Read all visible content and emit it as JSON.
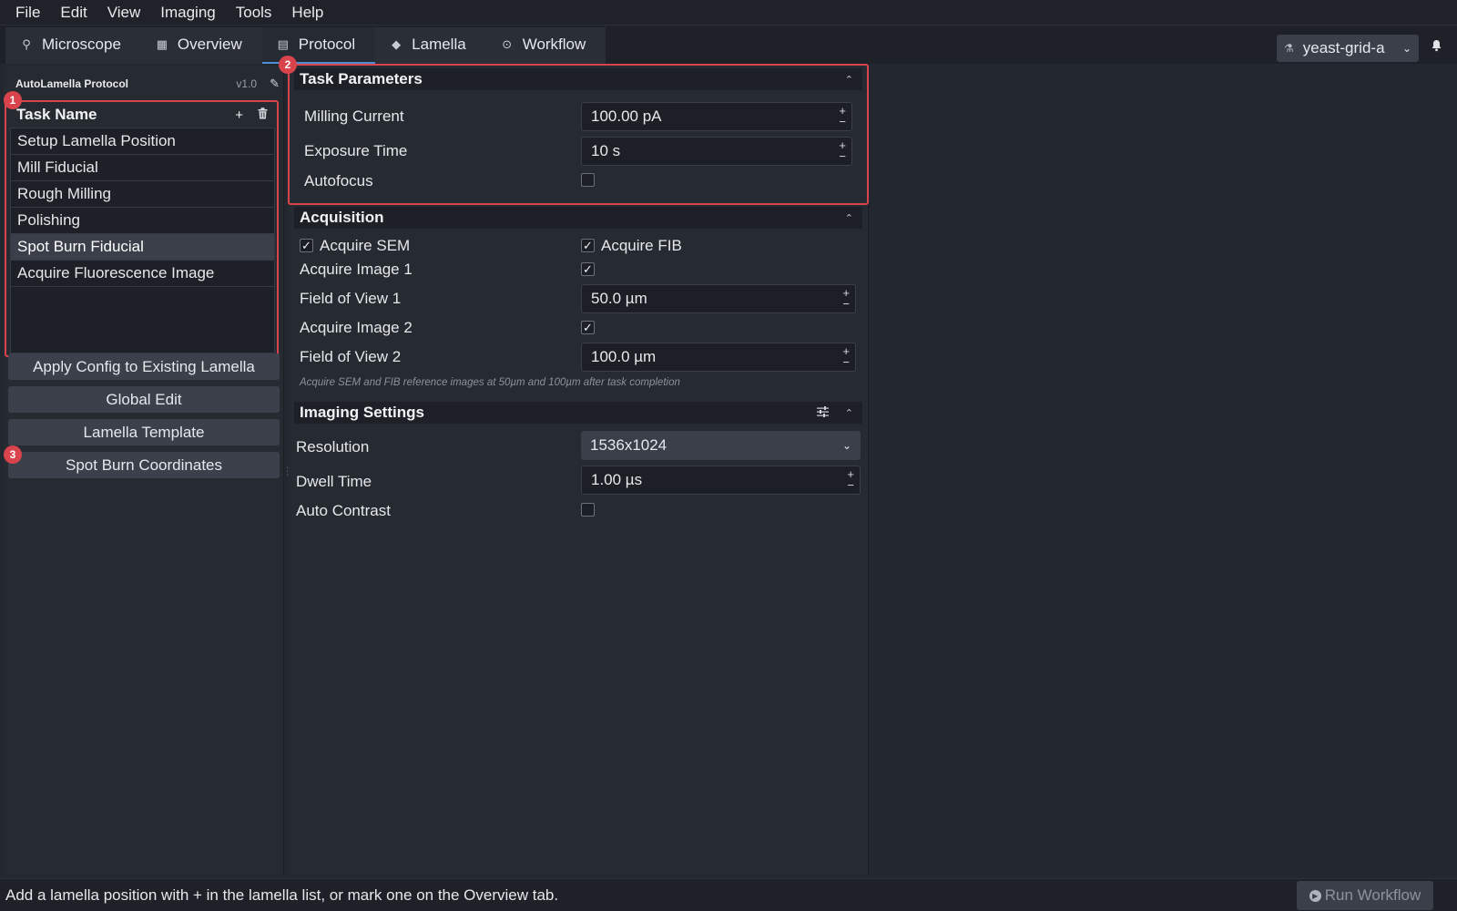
{
  "menu": [
    "File",
    "Edit",
    "View",
    "Imaging",
    "Tools",
    "Help"
  ],
  "tabs": [
    {
      "label": "Microscope",
      "icon": "microscope-icon"
    },
    {
      "label": "Overview",
      "icon": "map-icon"
    },
    {
      "label": "Protocol",
      "icon": "document-edit-icon"
    },
    {
      "label": "Lamella",
      "icon": "layers-icon"
    },
    {
      "label": "Workflow",
      "icon": "play-circle-icon"
    }
  ],
  "active_tab": "Protocol",
  "project": {
    "name": "yeast-grid-a",
    "icon": "flask-icon"
  },
  "protocol": {
    "title": "AutoLamella Protocol",
    "version": "v1.0"
  },
  "task_list": {
    "header": "Task Name",
    "items": [
      "Setup Lamella Position",
      "Mill Fiducial",
      "Rough Milling",
      "Polishing",
      "Spot Burn Fiducial",
      "Acquire Fluorescence Image"
    ],
    "selected": "Spot Burn Fiducial"
  },
  "left_buttons": [
    "Apply Config to Existing Lamella",
    "Global Edit",
    "Lamella Template",
    "Spot Burn Coordinates"
  ],
  "badges": [
    "1",
    "2",
    "3"
  ],
  "task_parameters": {
    "title": "Task Parameters",
    "milling_current_label": "Milling Current",
    "milling_current_value": "100.00 pA",
    "exposure_time_label": "Exposure Time",
    "exposure_time_value": "10 s",
    "autofocus_label": "Autofocus",
    "autofocus_checked": false
  },
  "acquisition": {
    "title": "Acquisition",
    "acquire_sem_label": "Acquire SEM",
    "acquire_sem_checked": true,
    "acquire_fib_label": "Acquire FIB",
    "acquire_fib_checked": true,
    "acquire_image1_label": "Acquire Image 1",
    "acquire_image1_checked": true,
    "fov1_label": "Field of View 1",
    "fov1_value": "50.0  µm",
    "acquire_image2_label": "Acquire Image 2",
    "acquire_image2_checked": true,
    "fov2_label": "Field of View 2",
    "fov2_value": "100.0  µm",
    "note": "Acquire SEM and FIB reference images at 50µm and 100µm after task completion"
  },
  "imaging_settings": {
    "title": "Imaging Settings",
    "resolution_label": "Resolution",
    "resolution_value": "1536x1024",
    "dwell_time_label": "Dwell Time",
    "dwell_time_value": "1.00 µs",
    "auto_contrast_label": "Auto Contrast",
    "auto_contrast_checked": false
  },
  "status": {
    "message": "Add a lamella position with + in the lamella list, or mark one on the Overview tab.",
    "run_button": "Run Workflow"
  },
  "glyphs": {
    "plus": "+",
    "minus": "−",
    "check": "✓",
    "caret_up": "⌃",
    "chevron_down": "⌄",
    "trash": "🗑",
    "pencil": "✎",
    "bell": "🔔",
    "sliders": "☰",
    "play": "▶",
    "grip": "⋮"
  },
  "colors": {
    "accent": "#4c8fd6",
    "highlight_border": "#d9434c",
    "background": "#23272f"
  }
}
